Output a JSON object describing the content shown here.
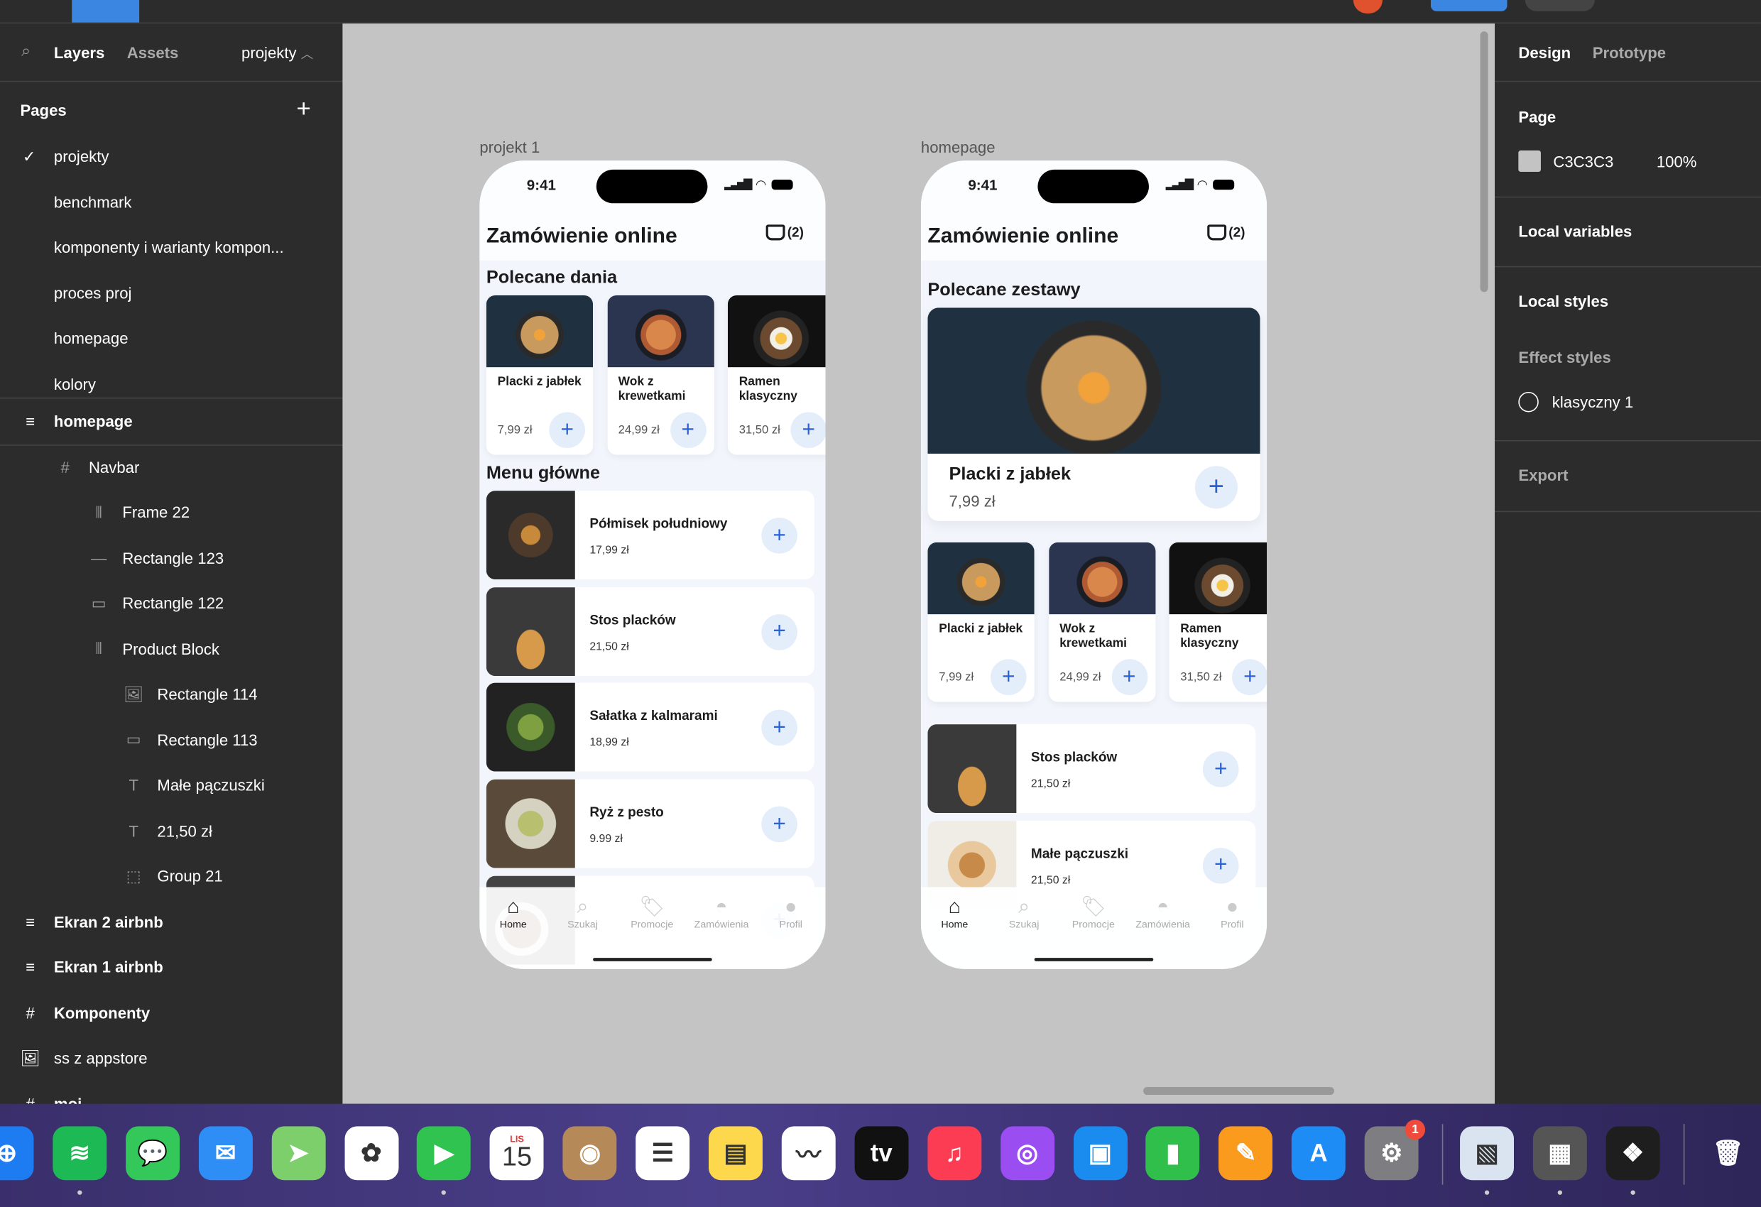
{
  "left_panel": {
    "tabs": {
      "layers": "Layers",
      "assets": "Assets"
    },
    "page_selector": "projekty",
    "pages_title": "Pages",
    "pages": [
      {
        "label": "projekty",
        "selected": true
      },
      {
        "label": "benchmark"
      },
      {
        "label": "komponenty i warianty kompon..."
      },
      {
        "label": "proces proj"
      },
      {
        "label": "homepage"
      },
      {
        "label": "kolory"
      }
    ],
    "layers": [
      {
        "label": "homepage",
        "icon": "≡",
        "level": 0,
        "bold": true
      },
      {
        "label": "Navbar",
        "icon": "#",
        "level": 1
      },
      {
        "label": "Frame 22",
        "icon": "⫴",
        "level": 2
      },
      {
        "label": "Rectangle 123",
        "icon": "—",
        "level": 2
      },
      {
        "label": "Rectangle 122",
        "icon": "▭",
        "level": 2
      },
      {
        "label": "Product Block",
        "icon": "⫴",
        "level": 2
      },
      {
        "label": "Rectangle 114",
        "icon": "🖼",
        "level": 3
      },
      {
        "label": "Rectangle 113",
        "icon": "▭",
        "level": 3
      },
      {
        "label": "Małe pączuszki",
        "icon": "T",
        "level": 3
      },
      {
        "label": "21,50 zł",
        "icon": "T",
        "level": 3
      },
      {
        "label": "Group 21",
        "icon": "⬚",
        "level": 3
      },
      {
        "label": "Ekran 2 airbnb",
        "icon": "≡",
        "level": 0,
        "bold": true
      },
      {
        "label": "Ekran 1 airbnb",
        "icon": "≡",
        "level": 0,
        "bold": true
      },
      {
        "label": "Komponenty",
        "icon": "#",
        "level": 0,
        "bold": true
      },
      {
        "label": "ss z appstore",
        "icon": "🖼",
        "level": 0
      },
      {
        "label": "moj",
        "icon": "#",
        "level": 0,
        "bold": true
      }
    ]
  },
  "right_panel": {
    "tabs": {
      "design": "Design",
      "prototype": "Prototype"
    },
    "page_title": "Page",
    "page_color": "C3C3C3",
    "page_opacity": "100%",
    "local_variables": "Local variables",
    "local_styles": "Local styles",
    "effect_styles": "Effect styles",
    "effect_item": "klasyczny 1",
    "export": "Export"
  },
  "canvas": {
    "background": "#c3c3c3",
    "frames": [
      {
        "label": "projekt 1",
        "time": "9:41",
        "title": "Zamówienie online",
        "cart_count": "(2)",
        "section1": "Polecane dania",
        "cards": [
          {
            "name": "Placki z jabłek",
            "price": "7,99 zł",
            "image": "pancakes"
          },
          {
            "name": "Wok z krewetkami",
            "price": "24,99 zł",
            "image": "wok"
          },
          {
            "name": "Ramen klasyczny",
            "price": "31,50 zł",
            "image": "ramen"
          }
        ],
        "section2": "Menu główne",
        "rows": [
          {
            "name": "Półmisek południowy",
            "price": "17,99 zł",
            "image": "platter"
          },
          {
            "name": "Stos placków",
            "price": "21,50 zł",
            "image": "stack"
          },
          {
            "name": "Sałatka z kalmarami",
            "price": "18,99 zł",
            "image": "salad"
          },
          {
            "name": "Ryż z pesto",
            "price": "9.99 zł",
            "image": "rice"
          },
          {
            "name": "",
            "price": "",
            "image": "cake"
          }
        ]
      },
      {
        "label": "homepage",
        "time": "9:41",
        "title": "Zamówienie online",
        "cart_count": "(2)",
        "section1": "Polecane zestawy",
        "featured": {
          "name": "Placki z jabłek",
          "price": "7,99 zł",
          "image": "pancakes"
        },
        "cards": [
          {
            "name": "Placki z jabłek",
            "price": "7,99 zł",
            "image": "pancakes"
          },
          {
            "name": "Wok z krewetkami",
            "price": "24,99 zł",
            "image": "wok"
          },
          {
            "name": "Ramen klasyczny",
            "price": "31,50 zł",
            "image": "ramen"
          }
        ],
        "rows": [
          {
            "name": "Stos placków",
            "price": "21,50 zł",
            "image": "stack"
          },
          {
            "name": "Małe pączuszki",
            "price": "21,50 zł",
            "image": "donuts"
          }
        ]
      }
    ],
    "nav": [
      {
        "label": "Home",
        "icon": "home-icon",
        "active": true
      },
      {
        "label": "Szukaj",
        "icon": "search-icon"
      },
      {
        "label": "Promocje",
        "icon": "tag-icon"
      },
      {
        "label": "Zamówienia",
        "icon": "cloche-icon"
      },
      {
        "label": "Profil",
        "icon": "profile-icon"
      }
    ],
    "accent": "#2a62d6"
  },
  "dock": {
    "apps": [
      {
        "icon": "safari-icon",
        "bg": "#1e7cf2",
        "glyph": "⊕"
      },
      {
        "icon": "spotify-icon",
        "bg": "#1db954",
        "glyph": "≋",
        "running": true
      },
      {
        "icon": "messages-icon",
        "bg": "#34c759",
        "glyph": "💬"
      },
      {
        "icon": "mail-icon",
        "bg": "#2f8ef5",
        "glyph": "✉"
      },
      {
        "icon": "maps-icon",
        "bg": "#7ccf6b",
        "glyph": "➤"
      },
      {
        "icon": "photos-icon",
        "bg": "#ffffff",
        "glyph": "✿"
      },
      {
        "icon": "facetime-icon",
        "bg": "#30c350",
        "glyph": "▶",
        "running": true
      },
      {
        "icon": "calendar-icon",
        "bg": "#ffffff",
        "glyph": "15",
        "month": "LIS"
      },
      {
        "icon": "contacts-icon",
        "bg": "#b58a58",
        "glyph": "◉"
      },
      {
        "icon": "reminders-icon",
        "bg": "#ffffff",
        "glyph": "☰"
      },
      {
        "icon": "notes-icon",
        "bg": "#fdd84c",
        "glyph": "▤"
      },
      {
        "icon": "freeform-icon",
        "bg": "#ffffff",
        "glyph": "〰"
      },
      {
        "icon": "tv-icon",
        "bg": "#111111",
        "glyph": "tv"
      },
      {
        "icon": "music-icon",
        "bg": "#fb3c52",
        "glyph": "♫"
      },
      {
        "icon": "podcasts-icon",
        "bg": "#9a4df0",
        "glyph": "◎"
      },
      {
        "icon": "keynote-icon",
        "bg": "#1a8cf0",
        "glyph": "▣"
      },
      {
        "icon": "numbers-icon",
        "bg": "#2fbf4a",
        "glyph": "▮"
      },
      {
        "icon": "pages-icon",
        "bg": "#fb9b1d",
        "glyph": "✎"
      },
      {
        "icon": "app-store-icon",
        "bg": "#1d8cf5",
        "glyph": "A"
      },
      {
        "icon": "system-settings-icon",
        "bg": "#7d7d82",
        "glyph": "⚙",
        "badge": "1"
      },
      {
        "icon": "preview-icon",
        "bg": "#d9e4f0",
        "glyph": "▧",
        "running": true
      },
      {
        "icon": "calculator-icon",
        "bg": "#555555",
        "glyph": "▦",
        "running": true
      },
      {
        "icon": "figma-icon",
        "bg": "#1e1e1e",
        "glyph": "❖",
        "running": true
      },
      {
        "icon": "trash-icon",
        "bg": "transparent",
        "glyph": "🗑"
      }
    ]
  }
}
